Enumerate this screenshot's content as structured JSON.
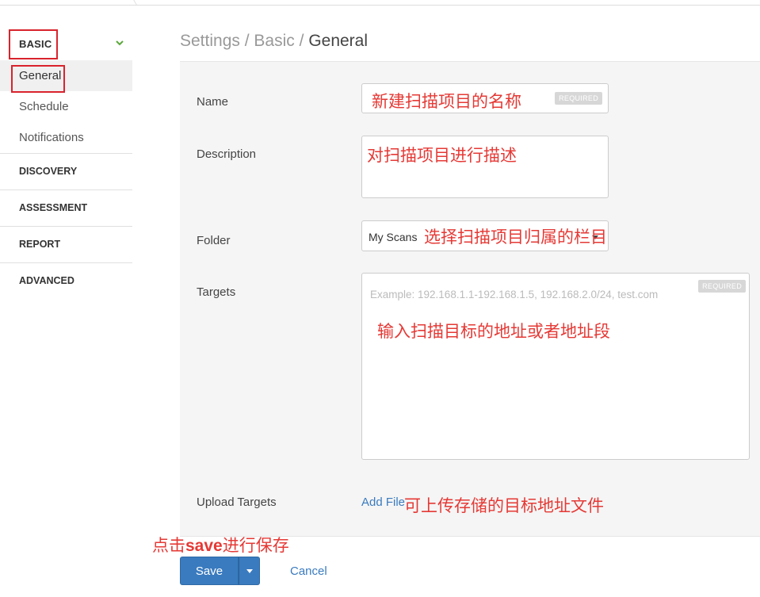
{
  "sidebar": {
    "basic_label": "BASIC",
    "basic_items": [
      "General",
      "Schedule",
      "Notifications"
    ],
    "sections": [
      "DISCOVERY",
      "ASSESSMENT",
      "REPORT",
      "ADVANCED"
    ]
  },
  "breadcrumb": {
    "part1": "Settings",
    "sep": "/",
    "part2": "Basic",
    "current": "General"
  },
  "form": {
    "name_label": "Name",
    "name_value": "新建扫描项目的名称",
    "required_badge": "REQUIRED",
    "description_label": "Description",
    "description_value": "对扫描项目进行描述",
    "folder_label": "Folder",
    "folder_value": "My Scans",
    "folder_note": "选择扫描项目归属的栏目",
    "targets_label": "Targets",
    "targets_placeholder": "Example: 192.168.1.1-192.168.1.5, 192.168.2.0/24, test.com",
    "targets_value": "输入扫描目标的地址或者地址段",
    "upload_label": "Upload Targets",
    "add_file": "Add File",
    "upload_note": "可上传存储的目标地址文件"
  },
  "actions": {
    "save_note_prefix": "点击",
    "save_note_bold": "save",
    "save_note_suffix": "进行保存",
    "save": "Save",
    "cancel": "Cancel"
  },
  "colors": {
    "accent": "#3a7bbf",
    "annotation": "#e53935",
    "highlight_box": "#d9232d",
    "chevron": "#5aa83a"
  }
}
